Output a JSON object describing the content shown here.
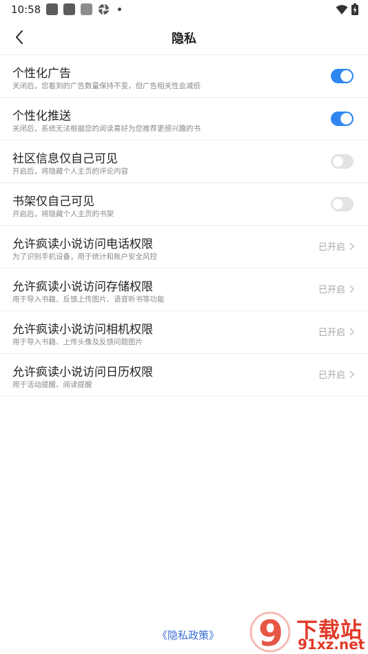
{
  "status_bar": {
    "time": "10:58",
    "icons": [
      "app-notification-icon",
      "app-notification-icon",
      "app-notification-icon",
      "aperture-icon",
      "more-dot-icon",
      "wifi-icon",
      "battery-charging-icon"
    ]
  },
  "header": {
    "title": "隐私"
  },
  "toggles": [
    {
      "title": "个性化广告",
      "desc": "关闭后，您看到的广告数量保持不变，但广告相关性会减低",
      "on": true
    },
    {
      "title": "个性化推送",
      "desc": "关闭后，系统无法根据您的阅读喜好为您推荐更感兴趣的书",
      "on": true
    },
    {
      "title": "社区信息仅自己可见",
      "desc": "开启后，将隐藏个人主页的评论内容",
      "on": false
    },
    {
      "title": "书架仅自己可见",
      "desc": "开启后，将隐藏个人主页的书架",
      "on": false
    }
  ],
  "permissions": [
    {
      "title": "允许疯读小说访问电话权限",
      "desc": "为了识别手机设备，用于统计和账户安全风控",
      "status": "已开启"
    },
    {
      "title": "允许疯读小说访问存储权限",
      "desc": "用于导入书籍、反馈上传图片、语音听书等功能",
      "status": "已开启"
    },
    {
      "title": "允许疯读小说访问相机权限",
      "desc": "用于导入书籍、上传头像及反馈问题图片",
      "status": "已开启"
    },
    {
      "title": "允许疯读小说访问日历权限",
      "desc": "用于活动提醒、阅读提醒",
      "status": "已开启"
    }
  ],
  "footer": {
    "policy_link": "《隐私政策》"
  },
  "watermark": {
    "logo_text": "9",
    "line1": "下载站",
    "line2": "91xz.net"
  },
  "colors": {
    "accent": "#2f86f1",
    "toggle_off": "#e3e3e3",
    "link": "#3b6fd6",
    "watermark": "#e23a28"
  }
}
